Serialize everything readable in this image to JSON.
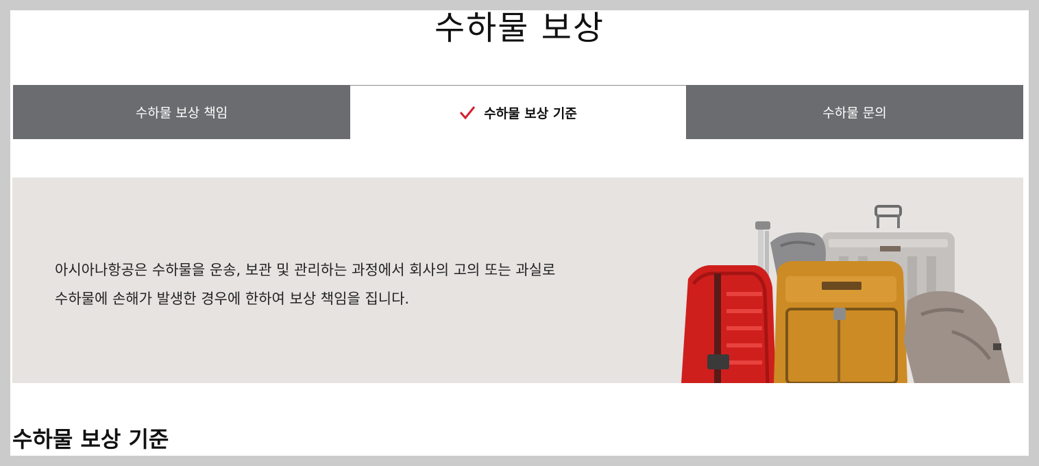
{
  "page": {
    "title": "수하물 보상"
  },
  "tabs": [
    {
      "label": "수하물 보상 책임",
      "active": false
    },
    {
      "label": "수하물 보상 기준",
      "active": true
    },
    {
      "label": "수하물 문의",
      "active": false
    }
  ],
  "intro": {
    "line1": "아시아나항공은 수하물을 운송, 보관 및 관리하는 과정에서 회사의 고의 또는 과실로",
    "line2": "수하물에 손해가 발생한 경우에 한하여 보상 책임을 집니다.",
    "image_icon": "luggage-image"
  },
  "section": {
    "heading": "수하물 보상 기준"
  },
  "colors": {
    "tab_inactive_bg": "#6b6c6f",
    "accent_check": "#d4202f",
    "intro_bg": "#e6e3e1"
  }
}
